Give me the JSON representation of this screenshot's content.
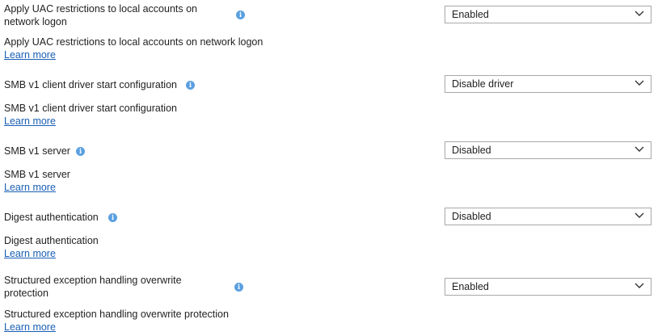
{
  "settings": [
    {
      "label": "Apply UAC restrictions to local accounts on network logon",
      "info_icon": "info-icon",
      "description": "Apply UAC restrictions to local accounts on network logon",
      "learn_more": "Learn more",
      "value": "Enabled"
    },
    {
      "label": "SMB v1 client driver start configuration",
      "info_icon": "info-icon",
      "description": "SMB v1 client driver start configuration",
      "learn_more": "Learn more",
      "value": "Disable driver"
    },
    {
      "label": "SMB v1 server",
      "info_icon": "info-icon",
      "description": "SMB v1 server",
      "learn_more": "Learn more",
      "value": "Disabled"
    },
    {
      "label": "Digest authentication",
      "info_icon": "info-icon",
      "description": "Digest authentication",
      "learn_more": "Learn more",
      "value": "Disabled"
    },
    {
      "label": "Structured exception handling overwrite protection",
      "info_icon": "info-icon",
      "description": "Structured exception handling overwrite protection",
      "learn_more": "Learn more",
      "value": "Enabled"
    }
  ],
  "icons": {
    "info": "info-icon",
    "dropdown": "chevron-down-icon"
  },
  "colors": {
    "link": "#1a5fb4",
    "info_icon": "#5aa0e0",
    "select_border": "#a8a8a8"
  }
}
